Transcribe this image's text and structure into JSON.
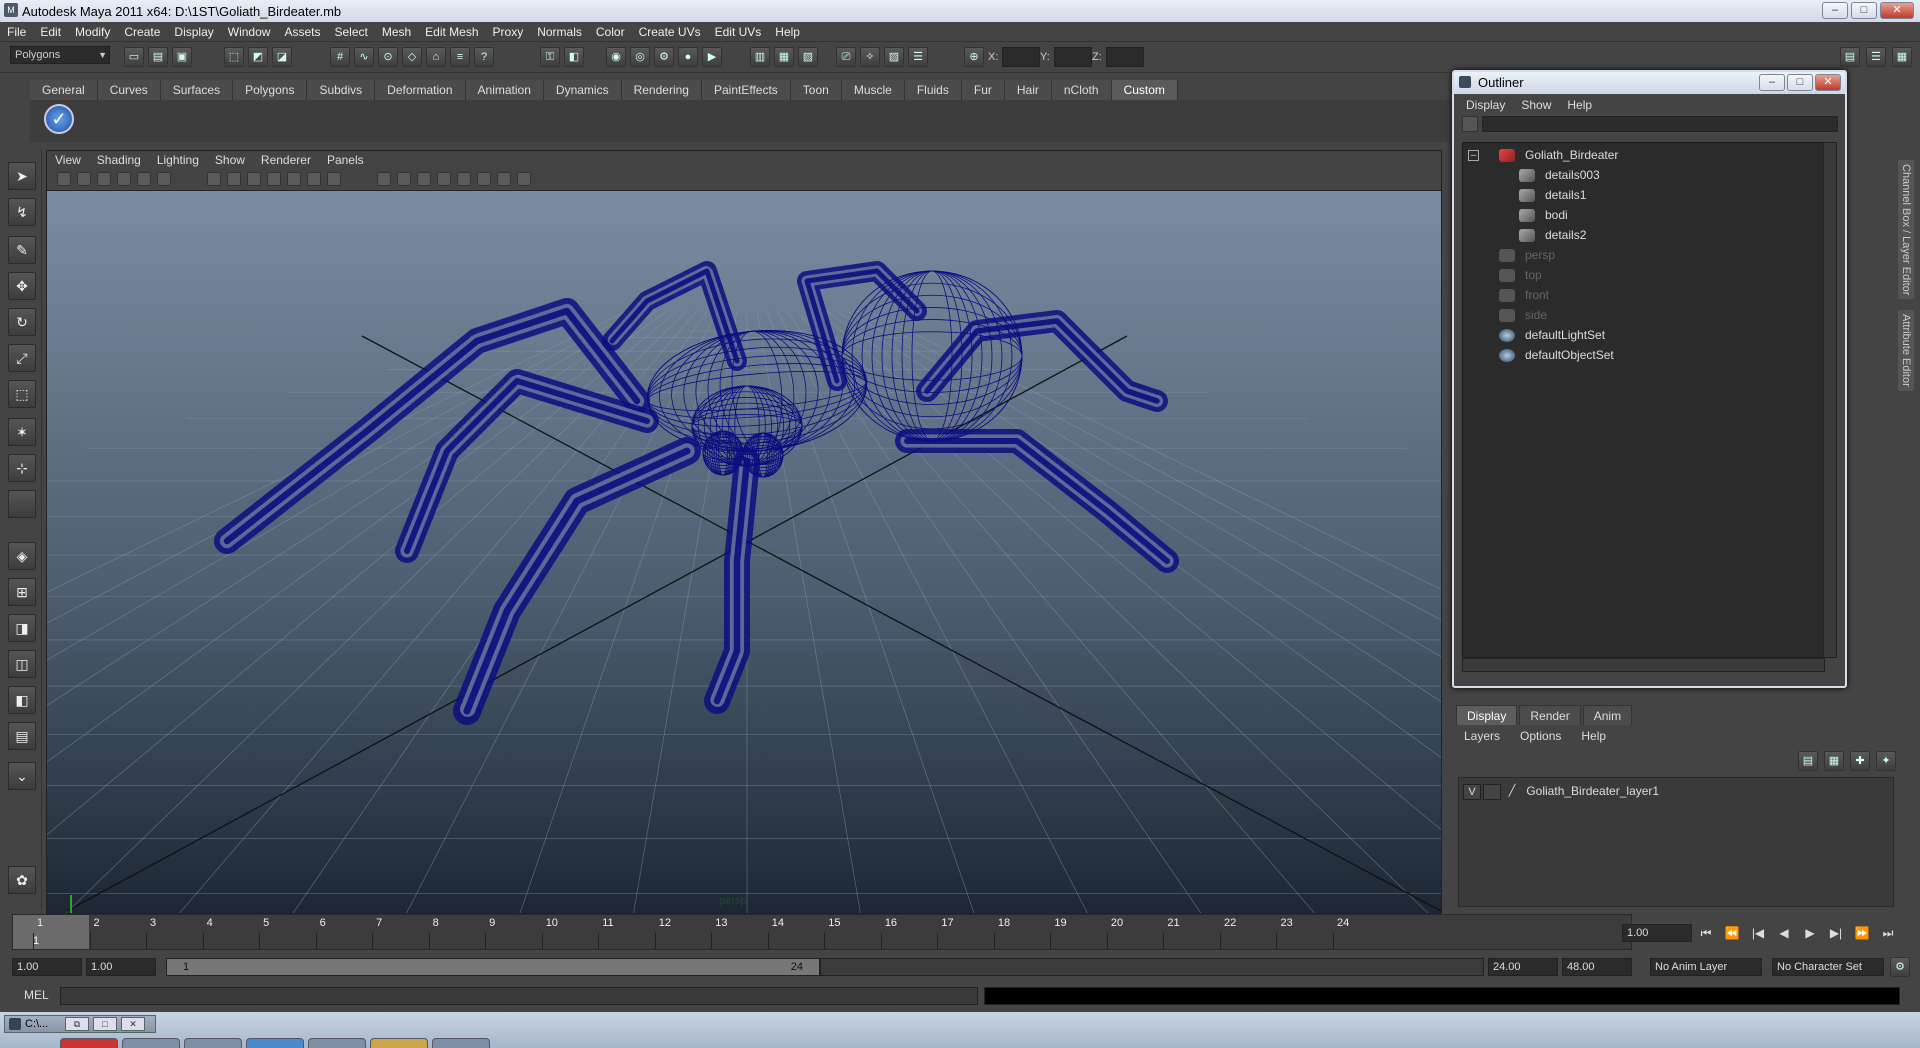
{
  "window": {
    "title": "Autodesk Maya 2011 x64: D:\\1ST\\Goliath_Birdeater.mb",
    "minimize": "–",
    "maximize": "□",
    "close": "✕"
  },
  "menubar": [
    "File",
    "Edit",
    "Modify",
    "Create",
    "Display",
    "Window",
    "Assets",
    "Select",
    "Mesh",
    "Edit Mesh",
    "Proxy",
    "Normals",
    "Color",
    "Create UVs",
    "Edit UVs",
    "Help"
  ],
  "statusline": {
    "mode": "Polygons",
    "x_label": "X:",
    "y_label": "Y:",
    "z_label": "Z:"
  },
  "shelf": {
    "tabs": [
      "General",
      "Curves",
      "Surfaces",
      "Polygons",
      "Subdivs",
      "Deformation",
      "Animation",
      "Dynamics",
      "Rendering",
      "PaintEffects",
      "Toon",
      "Muscle",
      "Fluids",
      "Fur",
      "Hair",
      "nCloth",
      "Custom"
    ],
    "active_tab": "Custom"
  },
  "viewport": {
    "menu": [
      "View",
      "Shading",
      "Lighting",
      "Show",
      "Renderer",
      "Panels"
    ],
    "camera_label": "persp",
    "wire_color": "#0d0d80"
  },
  "outliner": {
    "title": "Outliner",
    "menu": [
      "Display",
      "Show",
      "Help"
    ],
    "items": [
      {
        "label": "Goliath_Birdeater",
        "indent": 0,
        "kind": "root",
        "dim": false
      },
      {
        "label": "details003",
        "indent": 1,
        "kind": "mesh",
        "dim": false
      },
      {
        "label": "details1",
        "indent": 1,
        "kind": "mesh",
        "dim": false
      },
      {
        "label": "bodi",
        "indent": 1,
        "kind": "mesh",
        "dim": false
      },
      {
        "label": "details2",
        "indent": 1,
        "kind": "mesh",
        "dim": false
      },
      {
        "label": "persp",
        "indent": 0,
        "kind": "cam",
        "dim": true
      },
      {
        "label": "top",
        "indent": 0,
        "kind": "cam",
        "dim": true
      },
      {
        "label": "front",
        "indent": 0,
        "kind": "cam",
        "dim": true
      },
      {
        "label": "side",
        "indent": 0,
        "kind": "cam",
        "dim": true
      },
      {
        "label": "defaultLightSet",
        "indent": 0,
        "kind": "set",
        "dim": false
      },
      {
        "label": "defaultObjectSet",
        "indent": 0,
        "kind": "set",
        "dim": false
      }
    ]
  },
  "layers": {
    "tabs": [
      "Display",
      "Render",
      "Anim"
    ],
    "active_tab": "Display",
    "menu": [
      "Layers",
      "Options",
      "Help"
    ],
    "layer": {
      "visible": "V",
      "name": "Goliath_Birdeater_layer1"
    }
  },
  "right_tabs": [
    "Channel Box / Layer Editor",
    "Attribute Editor"
  ],
  "timeline": {
    "ticks": [
      1,
      2,
      3,
      4,
      5,
      6,
      7,
      8,
      9,
      10,
      11,
      12,
      13,
      14,
      15,
      16,
      17,
      18,
      19,
      20,
      21,
      22,
      23,
      24
    ],
    "current_frame": "1",
    "current_time_field": "1.00"
  },
  "range": {
    "start": "1.00",
    "playback_start": "1.00",
    "slider_start": "1",
    "slider_end": "24",
    "playback_end": "24.00",
    "end": "48.00",
    "anim_layer": "No Anim Layer",
    "character_set": "No Character Set"
  },
  "commandline": {
    "label": "MEL"
  },
  "taskbar": {
    "item": "C:\\..."
  }
}
